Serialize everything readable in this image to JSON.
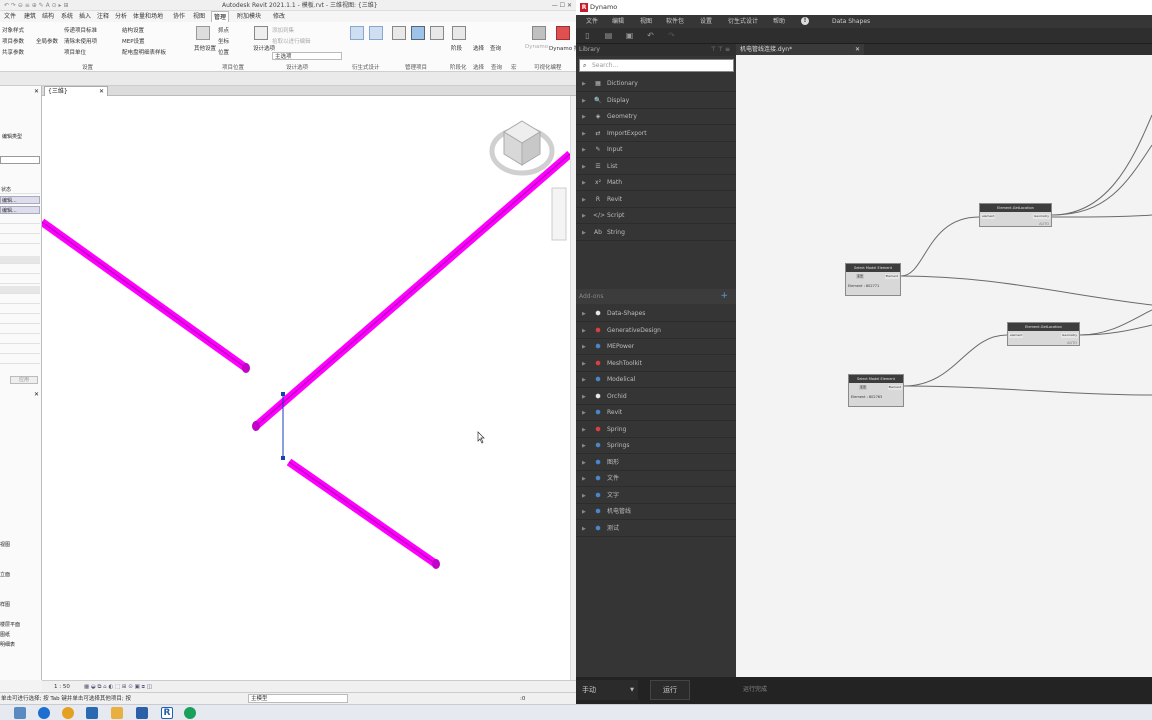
{
  "revit": {
    "title": "Autodesk Revit 2021.1.1 - 模板.rvt - 三维视图: {三维}",
    "tabs": [
      "文件",
      "建筑",
      "结构",
      "系统",
      "插入",
      "注释",
      "分析",
      "体量和场地",
      "协作",
      "视图",
      "管理",
      "附加模块",
      "修改"
    ],
    "active_tab": "管理",
    "ribbon": {
      "items": [
        "对象样式",
        "项目参数",
        "共享参数",
        "全局参数",
        "传递项目标准",
        "清除未使用项",
        "项目单位",
        "结构设置",
        "MEP设置",
        "配电盘明细表样板",
        "其他设置",
        "抓点",
        "坐标",
        "位置",
        "设计选项",
        "主选项",
        "添加到集",
        "拾取以进行编辑",
        "管理链接",
        "管理图像",
        "贴花类型",
        "启动视图",
        "阶段",
        "选择",
        "查询",
        "宏",
        "Dynamo",
        "Dynamo 播放器"
      ],
      "groups": [
        "设置",
        "项目位置",
        "设计选项",
        "衍生式设计",
        "管理项目",
        "阶段化",
        "选择",
        "查询",
        "宏",
        "可视化编程"
      ]
    },
    "view_tab": "{三维}",
    "left_panel": {
      "type_selector": "编辑类型",
      "rows": [
        "状态",
        "编辑...",
        "编辑...",
        "应用"
      ],
      "browser_items": [
        "视图",
        "立面",
        "样图",
        "楼层平面",
        "图纸",
        "明细表",
        "族",
        "组",
        "链接"
      ]
    },
    "status": {
      "scale": "1 : 50",
      "hint": "单击可进行选择; 按 Tab 键并单击可选择其他项目; 按 Ctrl 键并单击",
      "model": "主模型",
      "filter": ":0"
    }
  },
  "dynamo": {
    "title": "Dynamo",
    "menu": [
      "文件",
      "编辑",
      "视图",
      "软件包",
      "设置",
      "衍生式设计",
      "帮助",
      "Data Shapes"
    ],
    "library_title": "Library",
    "search_placeholder": "Search...",
    "library_items": [
      {
        "label": "Dictionary",
        "icon": "▦"
      },
      {
        "label": "Display",
        "icon": "🔍"
      },
      {
        "label": "Geometry",
        "icon": "◈"
      },
      {
        "label": "ImportExport",
        "icon": "⇄"
      },
      {
        "label": "Input",
        "icon": "✎"
      },
      {
        "label": "List",
        "icon": "☰"
      },
      {
        "label": "Math",
        "icon": "x²"
      },
      {
        "label": "Revit",
        "icon": "R"
      },
      {
        "label": "Script",
        "icon": "</>"
      },
      {
        "label": "String",
        "icon": "Ab"
      }
    ],
    "addons_title": "Add-ons",
    "addon_items": [
      {
        "label": "Data-Shapes",
        "color": "#e8e8e8"
      },
      {
        "label": "GenerativeDesign",
        "color": "#d94040"
      },
      {
        "label": "MEPower",
        "color": "#4a86c8"
      },
      {
        "label": "MeshToolkit",
        "color": "#d94040"
      },
      {
        "label": "Modelical",
        "color": "#4a86c8"
      },
      {
        "label": "Orchid",
        "color": "#e8e8e8"
      },
      {
        "label": "Revit",
        "color": "#4a86c8"
      },
      {
        "label": "Spring",
        "color": "#d94040"
      },
      {
        "label": "Springs",
        "color": "#4a86c8"
      },
      {
        "label": "图形",
        "color": "#4a86c8"
      },
      {
        "label": "文件",
        "color": "#4a86c8"
      },
      {
        "label": "文字",
        "color": "#4a86c8"
      },
      {
        "label": "机电管线",
        "color": "#4a86c8"
      },
      {
        "label": "测试",
        "color": "#4a86c8"
      }
    ],
    "file_tab": "机电管线连接.dyn*",
    "nodes": [
      {
        "title": "Element.GetLocation",
        "in": "element",
        "out": "Geometry",
        "foot": "AUTO"
      },
      {
        "title": "Select Model Element",
        "in": "变更",
        "out": "Element",
        "value": "Element : 802771"
      },
      {
        "title": "Element.GetLocation",
        "in": "element",
        "out": "Geometry",
        "foot": "AUTO"
      },
      {
        "title": "Select Model Element",
        "in": "变更",
        "out": "Element",
        "value": "Element : 802763"
      }
    ],
    "run_mode": "手动",
    "run_button": "运行",
    "run_status": "运行完成"
  },
  "colors": {
    "pipe": "#ff00ff",
    "pipe_dark": "#c200c8",
    "accent": "#4a86c8",
    "revit_red": "#c41e2a"
  }
}
